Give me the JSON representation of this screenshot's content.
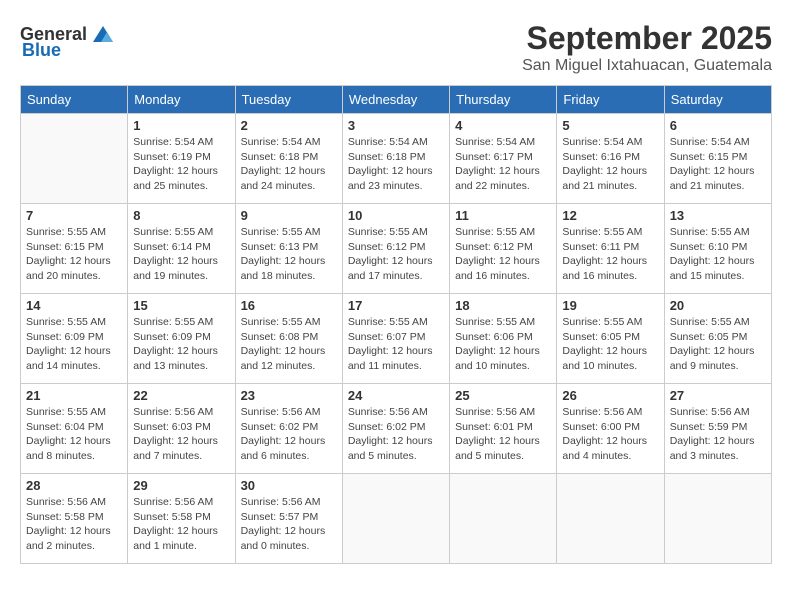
{
  "header": {
    "logo_general": "General",
    "logo_blue": "Blue",
    "month": "September 2025",
    "location": "San Miguel Ixtahuacan, Guatemala"
  },
  "weekdays": [
    "Sunday",
    "Monday",
    "Tuesday",
    "Wednesday",
    "Thursday",
    "Friday",
    "Saturday"
  ],
  "weeks": [
    [
      {
        "day": "",
        "info": ""
      },
      {
        "day": "1",
        "info": "Sunrise: 5:54 AM\nSunset: 6:19 PM\nDaylight: 12 hours\nand 25 minutes."
      },
      {
        "day": "2",
        "info": "Sunrise: 5:54 AM\nSunset: 6:18 PM\nDaylight: 12 hours\nand 24 minutes."
      },
      {
        "day": "3",
        "info": "Sunrise: 5:54 AM\nSunset: 6:18 PM\nDaylight: 12 hours\nand 23 minutes."
      },
      {
        "day": "4",
        "info": "Sunrise: 5:54 AM\nSunset: 6:17 PM\nDaylight: 12 hours\nand 22 minutes."
      },
      {
        "day": "5",
        "info": "Sunrise: 5:54 AM\nSunset: 6:16 PM\nDaylight: 12 hours\nand 21 minutes."
      },
      {
        "day": "6",
        "info": "Sunrise: 5:54 AM\nSunset: 6:15 PM\nDaylight: 12 hours\nand 21 minutes."
      }
    ],
    [
      {
        "day": "7",
        "info": "Sunrise: 5:55 AM\nSunset: 6:15 PM\nDaylight: 12 hours\nand 20 minutes."
      },
      {
        "day": "8",
        "info": "Sunrise: 5:55 AM\nSunset: 6:14 PM\nDaylight: 12 hours\nand 19 minutes."
      },
      {
        "day": "9",
        "info": "Sunrise: 5:55 AM\nSunset: 6:13 PM\nDaylight: 12 hours\nand 18 minutes."
      },
      {
        "day": "10",
        "info": "Sunrise: 5:55 AM\nSunset: 6:12 PM\nDaylight: 12 hours\nand 17 minutes."
      },
      {
        "day": "11",
        "info": "Sunrise: 5:55 AM\nSunset: 6:12 PM\nDaylight: 12 hours\nand 16 minutes."
      },
      {
        "day": "12",
        "info": "Sunrise: 5:55 AM\nSunset: 6:11 PM\nDaylight: 12 hours\nand 16 minutes."
      },
      {
        "day": "13",
        "info": "Sunrise: 5:55 AM\nSunset: 6:10 PM\nDaylight: 12 hours\nand 15 minutes."
      }
    ],
    [
      {
        "day": "14",
        "info": "Sunrise: 5:55 AM\nSunset: 6:09 PM\nDaylight: 12 hours\nand 14 minutes."
      },
      {
        "day": "15",
        "info": "Sunrise: 5:55 AM\nSunset: 6:09 PM\nDaylight: 12 hours\nand 13 minutes."
      },
      {
        "day": "16",
        "info": "Sunrise: 5:55 AM\nSunset: 6:08 PM\nDaylight: 12 hours\nand 12 minutes."
      },
      {
        "day": "17",
        "info": "Sunrise: 5:55 AM\nSunset: 6:07 PM\nDaylight: 12 hours\nand 11 minutes."
      },
      {
        "day": "18",
        "info": "Sunrise: 5:55 AM\nSunset: 6:06 PM\nDaylight: 12 hours\nand 10 minutes."
      },
      {
        "day": "19",
        "info": "Sunrise: 5:55 AM\nSunset: 6:05 PM\nDaylight: 12 hours\nand 10 minutes."
      },
      {
        "day": "20",
        "info": "Sunrise: 5:55 AM\nSunset: 6:05 PM\nDaylight: 12 hours\nand 9 minutes."
      }
    ],
    [
      {
        "day": "21",
        "info": "Sunrise: 5:55 AM\nSunset: 6:04 PM\nDaylight: 12 hours\nand 8 minutes."
      },
      {
        "day": "22",
        "info": "Sunrise: 5:56 AM\nSunset: 6:03 PM\nDaylight: 12 hours\nand 7 minutes."
      },
      {
        "day": "23",
        "info": "Sunrise: 5:56 AM\nSunset: 6:02 PM\nDaylight: 12 hours\nand 6 minutes."
      },
      {
        "day": "24",
        "info": "Sunrise: 5:56 AM\nSunset: 6:02 PM\nDaylight: 12 hours\nand 5 minutes."
      },
      {
        "day": "25",
        "info": "Sunrise: 5:56 AM\nSunset: 6:01 PM\nDaylight: 12 hours\nand 5 minutes."
      },
      {
        "day": "26",
        "info": "Sunrise: 5:56 AM\nSunset: 6:00 PM\nDaylight: 12 hours\nand 4 minutes."
      },
      {
        "day": "27",
        "info": "Sunrise: 5:56 AM\nSunset: 5:59 PM\nDaylight: 12 hours\nand 3 minutes."
      }
    ],
    [
      {
        "day": "28",
        "info": "Sunrise: 5:56 AM\nSunset: 5:58 PM\nDaylight: 12 hours\nand 2 minutes."
      },
      {
        "day": "29",
        "info": "Sunrise: 5:56 AM\nSunset: 5:58 PM\nDaylight: 12 hours\nand 1 minute."
      },
      {
        "day": "30",
        "info": "Sunrise: 5:56 AM\nSunset: 5:57 PM\nDaylight: 12 hours\nand 0 minutes."
      },
      {
        "day": "",
        "info": ""
      },
      {
        "day": "",
        "info": ""
      },
      {
        "day": "",
        "info": ""
      },
      {
        "day": "",
        "info": ""
      }
    ]
  ]
}
